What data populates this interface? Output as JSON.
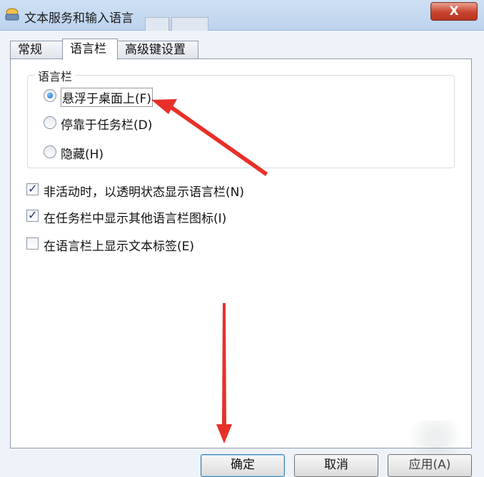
{
  "window": {
    "title": "文本服务和输入语言",
    "close_label": "X",
    "icon": "keyboard-language-icon"
  },
  "tabs": [
    {
      "label": "常规",
      "active": false
    },
    {
      "label": "语言栏",
      "active": true
    },
    {
      "label": "高级键设置",
      "active": false
    }
  ],
  "language_bar": {
    "group_label": "语言栏",
    "options": [
      {
        "label": "悬浮于桌面上",
        "hotkey": "(F)",
        "selected": true
      },
      {
        "label": "停靠于任务栏",
        "hotkey": "(D)",
        "selected": false
      },
      {
        "label": "隐藏",
        "hotkey": "(H)",
        "selected": false
      }
    ]
  },
  "checkboxes": [
    {
      "label": "非活动时，以透明状态显示语言栏",
      "hotkey": "(N)",
      "checked": true
    },
    {
      "label": "在任务栏中显示其他语言栏图标",
      "hotkey": "(I)",
      "checked": true
    },
    {
      "label": "在语言栏上显示文本标签",
      "hotkey": "(E)",
      "checked": false
    }
  ],
  "buttons": {
    "ok": "确定",
    "cancel": "取消",
    "apply": "应用(A)"
  },
  "colors": {
    "annotation_arrow": "#e8302a",
    "titlebar": "#c4d8f0",
    "close_button": "#c8432c"
  }
}
